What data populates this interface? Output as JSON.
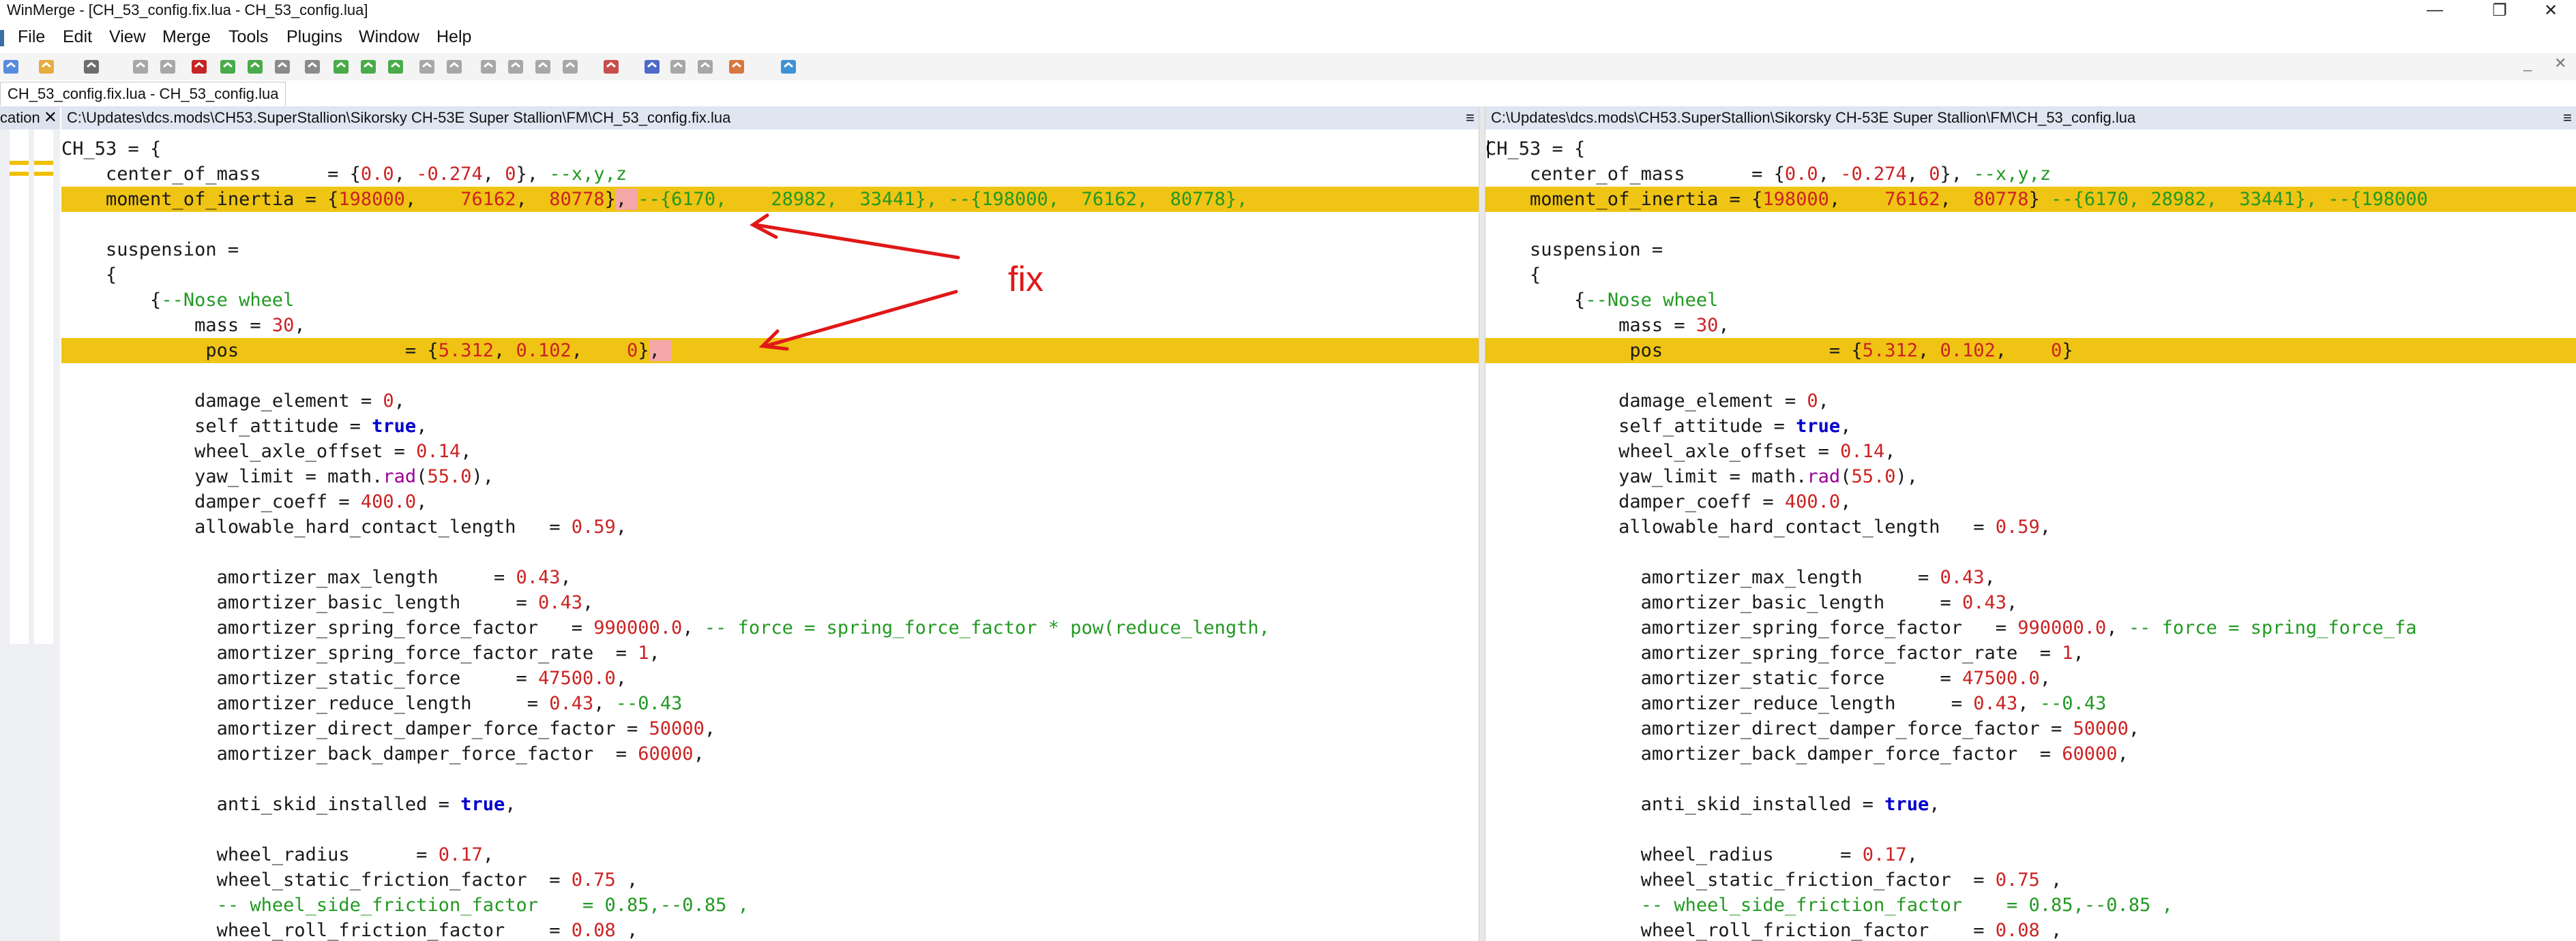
{
  "window": {
    "title": "WinMerge - [CH_53_config.fix.lua - CH_53_config.lua]",
    "minimize": "—",
    "restore": "❐",
    "close": "✕"
  },
  "menu": {
    "items": [
      "File",
      "Edit",
      "View",
      "Merge",
      "Tools",
      "Plugins",
      "Window",
      "Help"
    ]
  },
  "toolbar": {
    "icons": [
      "new-icon",
      "open-icon",
      "save-icon",
      "undo-icon",
      "redo-icon",
      "print-icon",
      "next-diff-icon",
      "prev-diff-icon",
      "first-diff-icon",
      "last-diff-icon",
      "current-diff-icon",
      "next-conflict-icon",
      "prev-conflict-icon",
      "copy-right-icon",
      "copy-left-icon",
      "copy-right-advance-icon",
      "copy-left-advance-icon",
      "all-right-icon",
      "all-left-icon",
      "compare-icon",
      "refresh-icon",
      "options-icon",
      "tools-icon",
      "bookmark-icon",
      "refresh-view-icon"
    ],
    "mdi_minimize": "_",
    "mdi_close": "✕"
  },
  "tabs": {
    "active_label": "CH_53_config.fix.lua - CH_53_config.lua"
  },
  "location_pane": {
    "header_text": "cation",
    "close": "✕"
  },
  "left_pane": {
    "path": "C:\\Updates\\dcs.mods\\CH53.SuperStallion\\Sikorsky CH-53E Super Stallion\\FM\\CH_53_config.fix.lua",
    "menu_glyph": "≡"
  },
  "right_pane": {
    "path": "C:\\Updates\\dcs.mods\\CH53.SuperStallion\\Sikorsky CH-53E Super Stallion\\FM\\CH_53_config.lua",
    "menu_glyph": "≡"
  },
  "annotation": {
    "text": "fix",
    "color": "#e01818"
  },
  "colors": {
    "diff_line": "#efc414",
    "diff_char": "#f4a8a8",
    "keyword": "#0000cc",
    "number": "#cc2222",
    "comment": "#229922",
    "function": "#990099"
  },
  "code": {
    "left": [
      "CH_53 = {",
      "    center_of_mass      = {0.0, -0.274, 0}, --x,y,z",
      "    moment_of_inertia = {198000,    76162,  80778}, --{6170,    28982,  33441}, --{198000,  76162,  80778},",
      "",
      "    suspension =",
      "    {",
      "        {--Nose wheel",
      "            mass = 30,",
      "             pos               = {5.312, 0.102,    0},",
      "",
      "            damage_element = 0,",
      "            self_attitude = true,",
      "            wheel_axle_offset = 0.14,",
      "            yaw_limit = math.rad(55.0),",
      "            damper_coeff = 400.0,",
      "            allowable_hard_contact_length   = 0.59,",
      "",
      "              amortizer_max_length     = 0.43,",
      "              amortizer_basic_length     = 0.43,",
      "              amortizer_spring_force_factor   = 990000.0, -- force = spring_force_factor * pow(reduce_length,",
      "              amortizer_spring_force_factor_rate  = 1,",
      "              amortizer_static_force     = 47500.0,",
      "              amortizer_reduce_length     = 0.43, --0.43",
      "              amortizer_direct_damper_force_factor = 50000,",
      "              amortizer_back_damper_force_factor  = 60000,",
      "",
      "              anti_skid_installed = true,",
      "",
      "              wheel_radius      = 0.17,",
      "              wheel_static_friction_factor  = 0.75 ,",
      "              -- wheel_side_friction_factor    = 0.85,--0.85 ,",
      "              wheel_roll_friction_factor    = 0.08 ,"
    ],
    "right": [
      "CH_53 = {",
      "    center_of_mass      = {0.0, -0.274, 0}, --x,y,z",
      "    moment_of_inertia = {198000,    76162,  80778} --{6170, 28982,  33441}, --{198000",
      "",
      "    suspension =",
      "    {",
      "        {--Nose wheel",
      "            mass = 30,",
      "             pos               = {5.312, 0.102,    0}",
      "",
      "            damage_element = 0,",
      "            self_attitude = true,",
      "            wheel_axle_offset = 0.14,",
      "            yaw_limit = math.rad(55.0),",
      "            damper_coeff = 400.0,",
      "            allowable_hard_contact_length   = 0.59,",
      "",
      "              amortizer_max_length     = 0.43,",
      "              amortizer_basic_length     = 0.43,",
      "              amortizer_spring_force_factor   = 990000.0, -- force = spring_force_fa",
      "              amortizer_spring_force_factor_rate  = 1,",
      "              amortizer_static_force     = 47500.0,",
      "              amortizer_reduce_length     = 0.43, --0.43",
      "              amortizer_direct_damper_force_factor = 50000,",
      "              amortizer_back_damper_force_factor  = 60000,",
      "",
      "              anti_skid_installed = true,",
      "",
      "              wheel_radius      = 0.17,",
      "              wheel_static_friction_factor  = 0.75 ,",
      "              -- wheel_side_friction_factor    = 0.85,--0.85 ,",
      "              wheel_roll_friction_factor    = 0.08 ,"
    ]
  }
}
